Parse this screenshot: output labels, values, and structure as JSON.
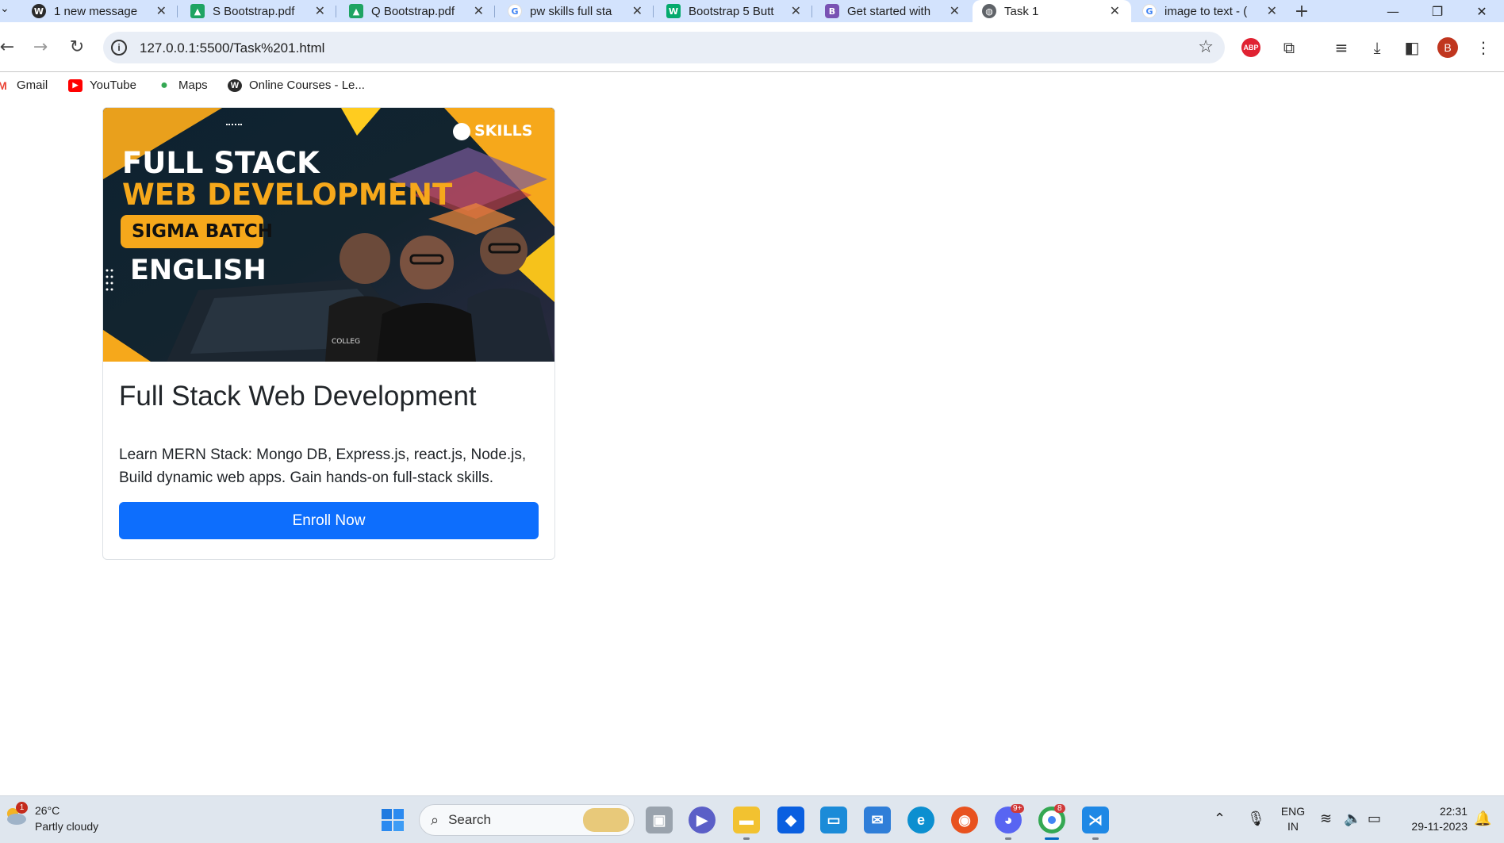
{
  "browser": {
    "tabs": [
      {
        "title": "1 new message",
        "icon": "wordpress-icon",
        "color": "#2b2b2b",
        "glyph": "W"
      },
      {
        "title": "S Bootstrap.pdf",
        "icon": "google-drive-icon",
        "color": "#1fa463",
        "glyph": "▲"
      },
      {
        "title": "Q Bootstrap.pdf",
        "icon": "google-drive-icon",
        "color": "#1fa463",
        "glyph": "▲"
      },
      {
        "title": "pw skills full sta",
        "icon": "google-icon",
        "color": "#4285f4",
        "glyph": "G"
      },
      {
        "title": "Bootstrap 5 Butt",
        "icon": "w3schools-icon",
        "color": "#04aa6d",
        "glyph": "W"
      },
      {
        "title": "Get started with",
        "icon": "bootstrap-icon",
        "color": "#7952b3",
        "glyph": "B"
      },
      {
        "title": "Task 1",
        "icon": "globe-icon",
        "color": "#5f6368",
        "glyph": "◍"
      },
      {
        "title": "image to text - (",
        "icon": "google-icon",
        "color": "#4285f4",
        "glyph": "G"
      }
    ],
    "active_tab_index": 6,
    "url": "127.0.0.1:5500/Task%201.html",
    "profile_initial": "B",
    "abp_label": "ABP"
  },
  "bookmarks": [
    {
      "label": "Gmail",
      "icon": "gmail-icon",
      "color": "#ea4335",
      "glyph": "M"
    },
    {
      "label": "YouTube",
      "icon": "youtube-icon",
      "color": "#ff0000",
      "glyph": "▶"
    },
    {
      "label": "Maps",
      "icon": "maps-icon",
      "color": "#34a853",
      "glyph": "●"
    },
    {
      "label": "Online Courses - Le...",
      "icon": "wordpress-icon",
      "color": "#2b2b2b",
      "glyph": "W"
    }
  ],
  "card": {
    "banner": {
      "line1": "FULL STACK",
      "line2": "WEB DEVELOPMENT",
      "badge": "SIGMA BATCH",
      "line3": "ENGLISH",
      "brand": "SKILLS",
      "shirt_label": "COLLEG"
    },
    "title": "Full Stack Web Development",
    "text": "Learn MERN Stack: Mongo DB, Express.js, react.js, Node.js, Build dynamic web apps. Gain hands-on full-stack skills.",
    "button_label": "Enroll Now"
  },
  "taskbar": {
    "weather_temp": "26°C",
    "weather_desc": "Partly cloudy",
    "weather_badge": "1",
    "search_placeholder": "Search",
    "discord_badge": "9+",
    "chrome_badge": "8",
    "lang_line1": "ENG",
    "lang_line2": "IN",
    "time": "22:31",
    "date": "29-11-2023"
  }
}
